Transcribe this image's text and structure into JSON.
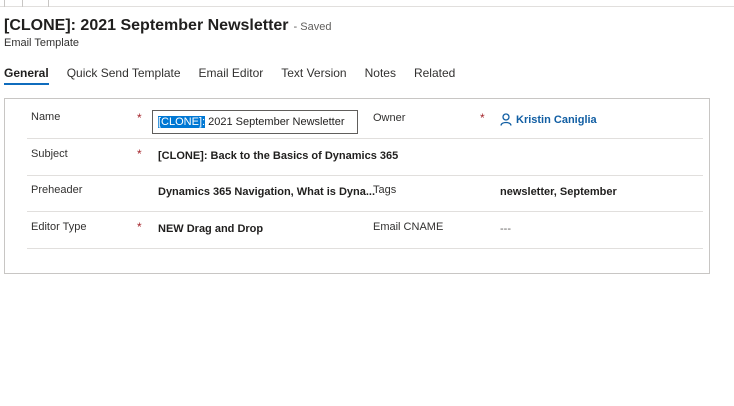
{
  "record": {
    "title": "[CLONE]: 2021 September Newsletter",
    "save_status": "- Saved",
    "entity_type": "Email Template"
  },
  "tabs": [
    {
      "label": "General",
      "active": true
    },
    {
      "label": "Quick Send Template"
    },
    {
      "label": "Email Editor"
    },
    {
      "label": "Text Version"
    },
    {
      "label": "Notes"
    },
    {
      "label": "Related"
    }
  ],
  "form": {
    "name": {
      "label": "Name",
      "required_mark": "*",
      "selected_part": "[CLONE]:",
      "rest": " 2021 September Newsletter"
    },
    "owner": {
      "label": "Owner",
      "required_mark": "*",
      "value": "Kristin Caniglia",
      "icon": "person-icon"
    },
    "subject": {
      "label": "Subject",
      "required_mark": "*",
      "value": "[CLONE]: Back to the Basics of Dynamics 365"
    },
    "preheader": {
      "label": "Preheader",
      "value": "Dynamics 365 Navigation, What is Dyna..."
    },
    "tags": {
      "label": "Tags",
      "value": "newsletter, September"
    },
    "editor_type": {
      "label": "Editor Type",
      "required_mark": "*",
      "value": "NEW Drag and Drop"
    },
    "email_cname": {
      "label": "Email CNAME",
      "value": "---"
    }
  },
  "colors": {
    "accent": "#0f6cbd",
    "required": "#a4262c",
    "link": "#115ea3"
  }
}
